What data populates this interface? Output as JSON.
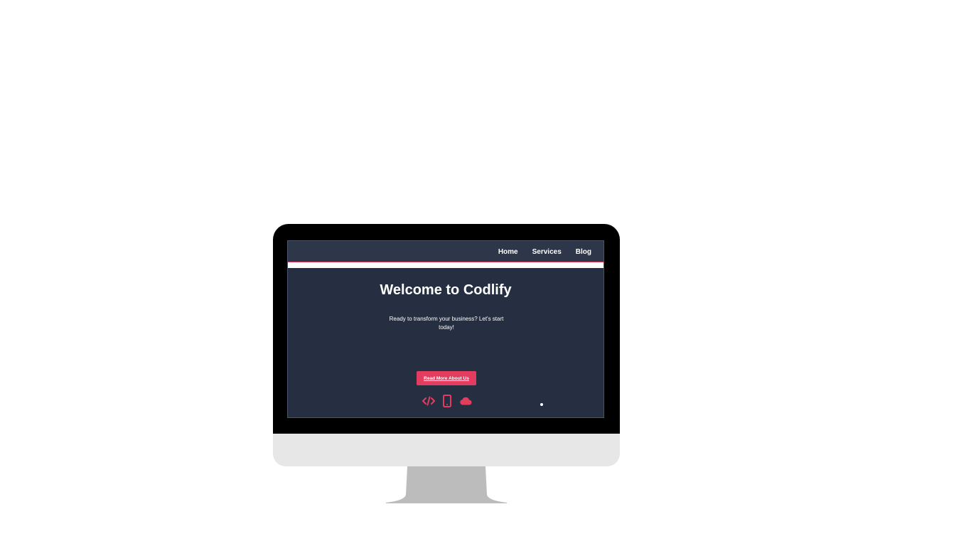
{
  "nav": {
    "links": [
      "Home",
      "Services",
      "Blog"
    ]
  },
  "hero": {
    "title": "Welcome to Codlify",
    "subtitle": "Ready to transform your business? Let's start today!",
    "cta_label": "Read More About Us"
  },
  "icons": [
    "code-icon",
    "mobile-icon",
    "cloud-icon"
  ],
  "colors": {
    "accent": "#e23d5e",
    "screen_background": "#262f41",
    "navbar_background": "#2e3649",
    "bezel": "#000000",
    "chin": "#e7e7e7",
    "stand": "#bcbcbc"
  }
}
